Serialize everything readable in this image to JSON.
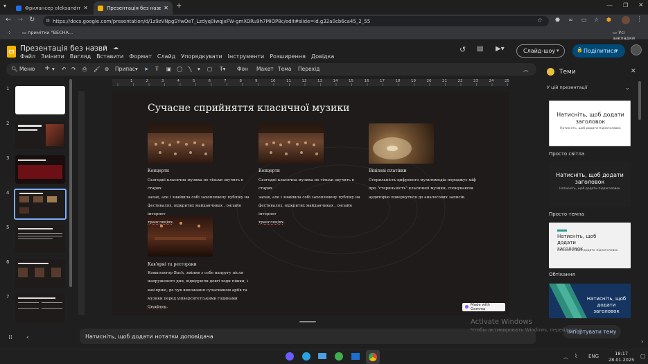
{
  "browser": {
    "tabs": [
      {
        "title": "Фрилансер oleksandrmazula1",
        "icon": "w-icon"
      },
      {
        "title": "Презентація без назви - Goog",
        "icon": "slides-icon"
      }
    ],
    "url": "https://docs.google.com/presentation/d/1z9zVNpgSYwOeT_Lzdyq0IwqjxFW-gmXORu9h7MiOP8c/edit#slide=id.g32a0cb6ca45_2_55",
    "bookmarks_label": "примітки \"ВЕСНА...",
    "all_bookmarks": "Усі закладки"
  },
  "docs": {
    "title": "Презентація без назви",
    "menu": [
      "Файл",
      "Змінити",
      "Вигляд",
      "Вставити",
      "Формат",
      "Слайд",
      "Упорядкувати",
      "Інструменти",
      "Розширення",
      "Довідка"
    ],
    "slideshow_label": "Слайд-шоу",
    "share_label": "Поділитися"
  },
  "toolbar": {
    "menu_label": "Меню",
    "zoom_label": "Припас",
    "background_label": "Фон",
    "layout_label": "Макет",
    "theme_label": "Тема",
    "transition_label": "Перехід"
  },
  "filmstrip": {
    "numbers": [
      "1",
      "2",
      "3",
      "4",
      "5",
      "6",
      "7"
    ],
    "selected": 4
  },
  "ruler": {
    "labels": [
      "1",
      "2",
      "3",
      "4",
      "5",
      "6",
      "7",
      "8",
      "9",
      "10",
      "11",
      "12",
      "13",
      "14",
      "15",
      "16",
      "17",
      "18",
      "19",
      "20",
      "21",
      "22",
      "23",
      "24",
      "25"
    ]
  },
  "slide": {
    "title": "Сучасне сприйняття класичної музики",
    "columns": [
      {
        "heading": "Концерти",
        "body_lines": [
          "Сьогодні класична музика не тільки звучить в старих",
          "залах, але і знайшла собі захоплюючу публіку на",
          "фестивалях, відкритих майданчиках , онлайн інтернет"
        ],
        "last_word": "трансляціях",
        "last_tail": "."
      },
      {
        "heading": "Концерти",
        "body_lines": [
          "Сьогодні класична музика не тільки звучить в старих",
          "залах, але і знайшла собі захоплюючу публіку на",
          "фестивалях, відкритих майданчиках , онлайн інтернет"
        ],
        "last_word": "трансляціях",
        "last_tail": "."
      },
      {
        "heading": "Вінілові платівки",
        "body_lines": [
          "Стерильність цифрового мультимедіа породжує міф",
          "про \"стерильність\" класичної музики, спонукаючи",
          "аудиторію повернутися до аналогових записів."
        ]
      }
    ],
    "bottom": {
      "heading": "Кав'ярні та ресторани",
      "body_lines": [
        "Композитор Bach, змінив з себе напругу після",
        "напруженого дня, відвідуючи довгі ходи пішки, і",
        "кав'ярню, де чув виконання сучасником аріїв та"
      ],
      "last_line_start": "музики перед університетськими годинами ",
      "last_word": "Grenberg",
      "last_tail": "."
    },
    "badge": "Made with Gamma"
  },
  "notes_placeholder": "Натисніть, щоб додати нотатки доповідача",
  "themes": {
    "title": "Теми",
    "subtitle": "У цій презентації",
    "cards": [
      {
        "title": "Натисніть, щоб додати заголовок",
        "subtitle": "Натисніть, щоб додати підзаголовок",
        "label": "Просто світла",
        "bg": "#ffffff",
        "fg": "#222222"
      },
      {
        "title": "Натисніть, щоб додати заголовок",
        "subtitle": "Натисніть, щоб додати підзаголовок",
        "label": "Просто темна",
        "bg": "#212121",
        "fg": "#ffffff"
      },
      {
        "title": "Натисніть, щоб додати заголовок",
        "subtitle": "Натисніть, щоб додати підзаголовок",
        "label": "Обтікання",
        "bg": "#f1f1f1",
        "fg": "#222222"
      },
      {
        "title": "Натисніть, щоб додати заголовок",
        "label": "",
        "bg": "#153560",
        "fg": "#ffffff"
      }
    ],
    "import_label": "Імпортувати тему"
  },
  "watermark": {
    "line1": "Activate Windows",
    "line2": "Чтобы активировать Windows, перейдите в"
  },
  "taskbar": {
    "lang": "ENG",
    "time": "18:17",
    "date": "28.01.2025"
  },
  "colors": {
    "accent": "#004a77",
    "accent_text": "#c2e7ff",
    "slide_bg": "#1e1b1a"
  }
}
